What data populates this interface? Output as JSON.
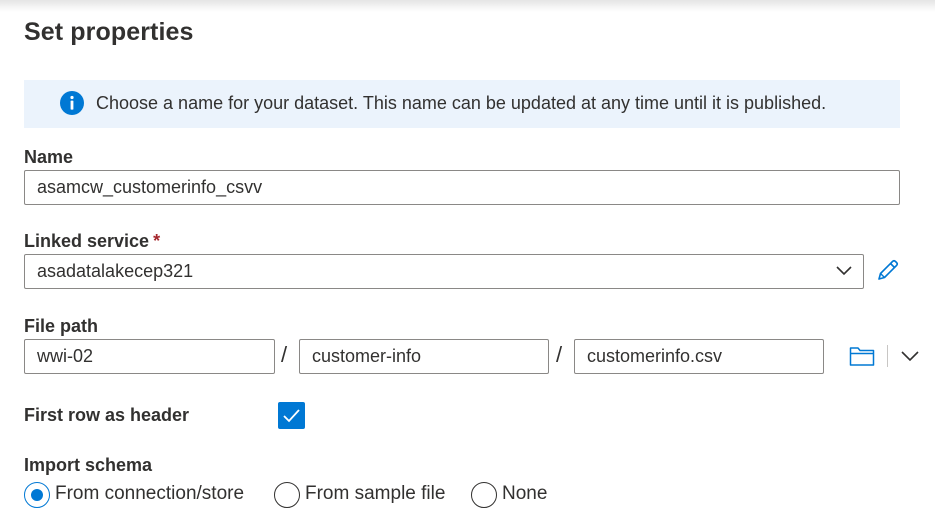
{
  "panel": {
    "title": "Set properties",
    "info_message": "Choose a name for your dataset. This name can be updated at any time until it is published."
  },
  "fields": {
    "name": {
      "label": "Name",
      "value": "asamcw_customerinfo_csvv"
    },
    "linked_service": {
      "label": "Linked service",
      "required_marker": "*",
      "selected": "asadatalakecep321"
    },
    "file_path": {
      "label": "File path",
      "separator": "/",
      "container": "wwi-02",
      "directory": "customer-info",
      "file": "customerinfo.csv"
    },
    "first_row_header": {
      "label": "First row as header",
      "checked": true
    },
    "import_schema": {
      "label": "Import schema",
      "options": [
        {
          "label": "From connection/store",
          "checked": true
        },
        {
          "label": "From sample file",
          "checked": false
        },
        {
          "label": "None",
          "checked": false
        }
      ]
    }
  },
  "icons": {
    "info": "info-icon",
    "chevron": "chevron-down-icon",
    "edit": "pencil-icon",
    "browse": "folder-icon"
  },
  "colors": {
    "accent": "#0078d4",
    "info_bg": "#ebf3fc",
    "required": "#a4262c",
    "border": "#8a8886"
  }
}
